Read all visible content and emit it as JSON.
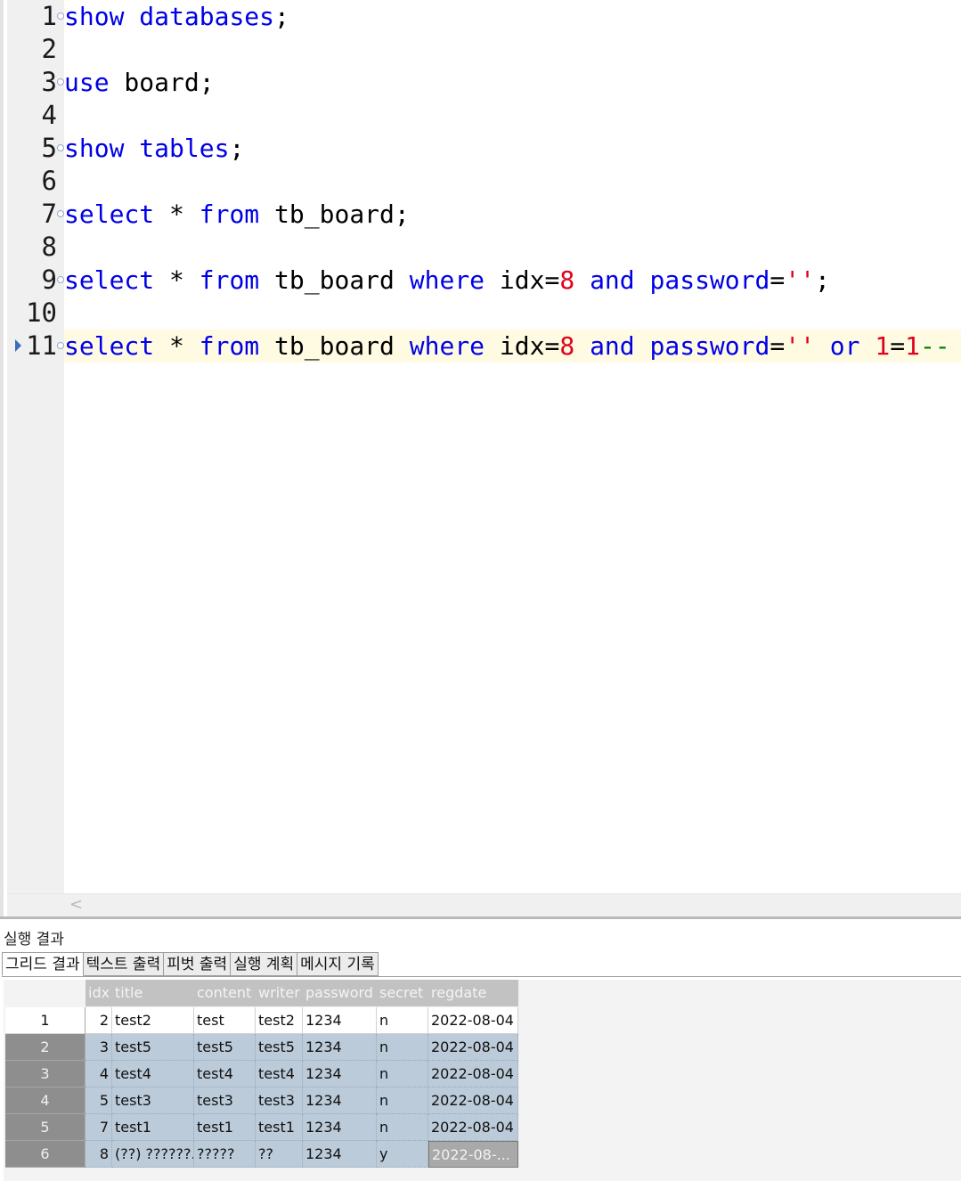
{
  "editor": {
    "lines": [
      {
        "num": "1",
        "fold": true,
        "tokens": [
          {
            "t": "show",
            "c": "kw"
          },
          {
            "t": " "
          },
          {
            "t": "databases",
            "c": "kw"
          },
          {
            "t": ";"
          }
        ]
      },
      {
        "num": "2",
        "fold": false,
        "tokens": []
      },
      {
        "num": "3",
        "fold": true,
        "tokens": [
          {
            "t": "use",
            "c": "kw"
          },
          {
            "t": " board;"
          }
        ]
      },
      {
        "num": "4",
        "fold": false,
        "tokens": []
      },
      {
        "num": "5",
        "fold": true,
        "tokens": [
          {
            "t": "show",
            "c": "kw"
          },
          {
            "t": " "
          },
          {
            "t": "tables",
            "c": "kw"
          },
          {
            "t": ";"
          }
        ]
      },
      {
        "num": "6",
        "fold": false,
        "tokens": []
      },
      {
        "num": "7",
        "fold": true,
        "tokens": [
          {
            "t": "select",
            "c": "kw"
          },
          {
            "t": " * "
          },
          {
            "t": "from",
            "c": "kw"
          },
          {
            "t": " tb_board;"
          }
        ]
      },
      {
        "num": "8",
        "fold": false,
        "tokens": []
      },
      {
        "num": "9",
        "fold": true,
        "tokens": [
          {
            "t": "select",
            "c": "kw"
          },
          {
            "t": " * "
          },
          {
            "t": "from",
            "c": "kw"
          },
          {
            "t": " tb_board "
          },
          {
            "t": "where",
            "c": "kw"
          },
          {
            "t": " idx="
          },
          {
            "t": "8",
            "c": "num"
          },
          {
            "t": " "
          },
          {
            "t": "and",
            "c": "kw"
          },
          {
            "t": " "
          },
          {
            "t": "password",
            "c": "kw"
          },
          {
            "t": "="
          },
          {
            "t": "''",
            "c": "str"
          },
          {
            "t": ";"
          }
        ]
      },
      {
        "num": "10",
        "fold": false,
        "tokens": []
      },
      {
        "num": "11",
        "fold": true,
        "current": true,
        "tokens": [
          {
            "t": "select",
            "c": "kw"
          },
          {
            "t": " * "
          },
          {
            "t": "from",
            "c": "kw"
          },
          {
            "t": " tb_board "
          },
          {
            "t": "where",
            "c": "kw"
          },
          {
            "t": " idx="
          },
          {
            "t": "8",
            "c": "num"
          },
          {
            "t": " "
          },
          {
            "t": "and",
            "c": "kw"
          },
          {
            "t": " "
          },
          {
            "t": "password",
            "c": "kw"
          },
          {
            "t": "="
          },
          {
            "t": "''",
            "c": "str"
          },
          {
            "t": " "
          },
          {
            "t": "or",
            "c": "kw"
          },
          {
            "t": " "
          },
          {
            "t": "1",
            "c": "num"
          },
          {
            "t": "="
          },
          {
            "t": "1",
            "c": "num"
          },
          {
            "t": "-- '",
            "c": "cmt"
          }
        ]
      }
    ]
  },
  "results": {
    "title": "실행 결과",
    "tabs": [
      "그리드 결과",
      "텍스트 출력",
      "피벗 출력",
      "실행 계획",
      "메시지 기록"
    ],
    "columns": [
      "idx",
      "title",
      "content",
      "writer",
      "password",
      "secret",
      "regdate"
    ],
    "rows": [
      {
        "no": "1",
        "cells": [
          "2",
          "test2",
          "test",
          "test2",
          "1234",
          "n",
          "2022-08-04"
        ]
      },
      {
        "no": "2",
        "cells": [
          "3",
          "test5",
          "test5",
          "test5",
          "1234",
          "n",
          "2022-08-04"
        ]
      },
      {
        "no": "3",
        "cells": [
          "4",
          "test4",
          "test4",
          "test4",
          "1234",
          "n",
          "2022-08-04"
        ]
      },
      {
        "no": "4",
        "cells": [
          "5",
          "test3",
          "test3",
          "test3",
          "1234",
          "n",
          "2022-08-04"
        ]
      },
      {
        "no": "5",
        "cells": [
          "7",
          "test1",
          "test1",
          "test1",
          "1234",
          "n",
          "2022-08-04"
        ]
      },
      {
        "no": "6",
        "cells": [
          "8",
          "(??) ??????.",
          "?????",
          "??",
          "1234",
          "y",
          "2022-08-..."
        ]
      }
    ],
    "selected_rows": [
      1,
      2,
      3,
      4,
      5
    ],
    "focused_cell": {
      "row": 5,
      "col": 6
    }
  }
}
